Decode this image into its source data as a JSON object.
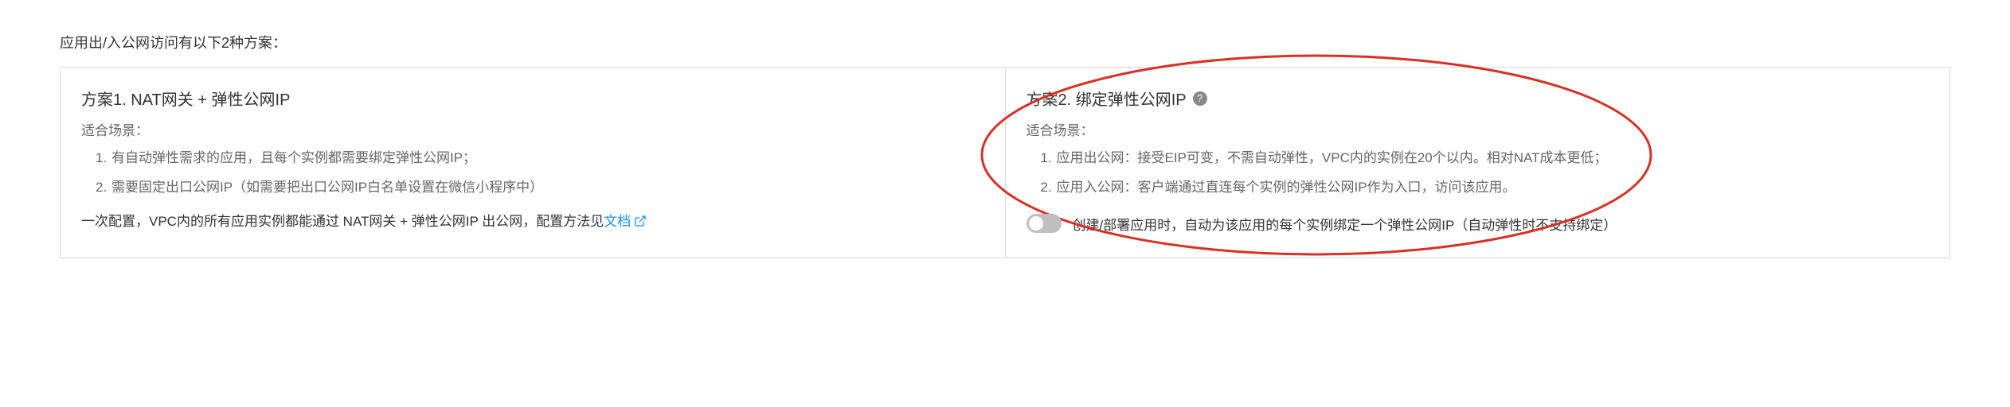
{
  "intro": "应用出/入公网访问有以下2种方案：",
  "plan1": {
    "title": "方案1. NAT网关 + 弹性公网IP",
    "scenario_label": "适合场景：",
    "items": [
      "有自动弹性需求的应用，且每个实例都需要绑定弹性公网IP；",
      "需要固定出口公网IP（如需要把出口公网IP白名单设置在微信小程序中）"
    ],
    "note_prefix": "一次配置，VPC内的所有应用实例都能通过 NAT网关 + 弹性公网IP 出公网，配置方法见",
    "link_text": "文档"
  },
  "plan2": {
    "title": "方案2. 绑定弹性公网IP",
    "scenario_label": "适合场景：",
    "items": [
      "应用出公网：接受EIP可变，不需自动弹性，VPC内的实例在20个以内。相对NAT成本更低；",
      "应用入公网：客户端通过直连每个实例的弹性公网IP作为入口，访问该应用。"
    ],
    "toggle_label": "创建/部署应用时，自动为该应用的每个实例绑定一个弹性公网IP（自动弹性时不支持绑定）"
  }
}
